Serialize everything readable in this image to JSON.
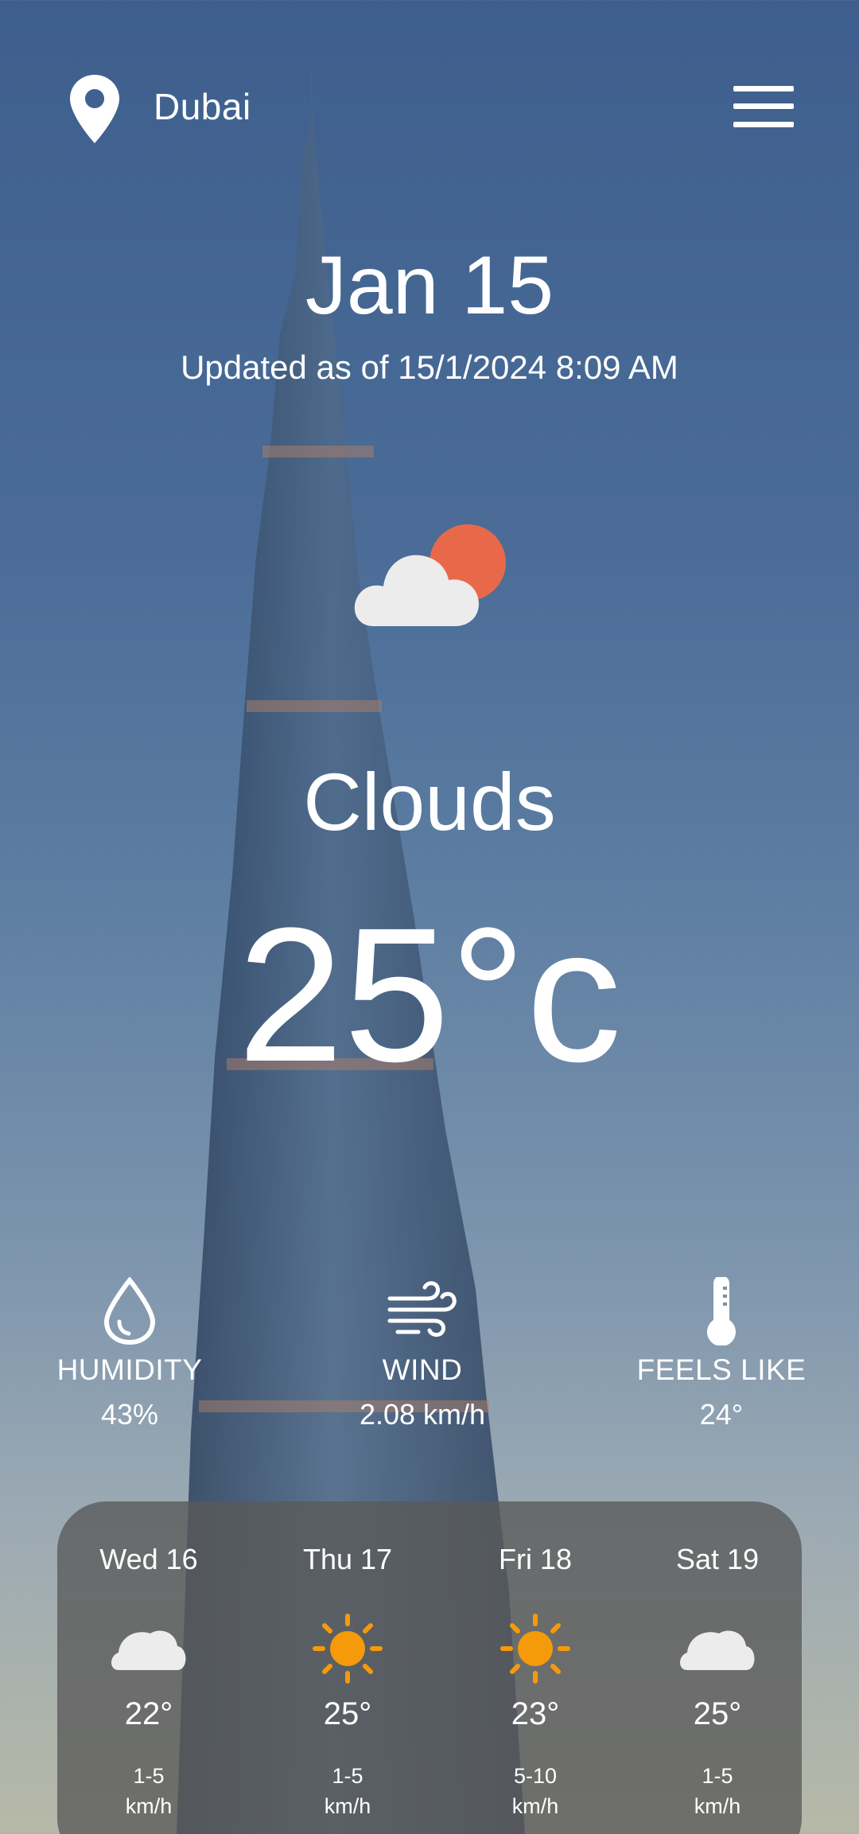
{
  "header": {
    "city": "Dubai",
    "location_icon": "location-pin-icon",
    "menu_icon": "hamburger-menu-icon"
  },
  "current": {
    "date": "Jan 15",
    "updated": "Updated as of 15/1/2024 8:09 AM",
    "condition_icon": "cloud-sun-icon",
    "condition": "Clouds",
    "temperature": "25°c"
  },
  "stats": {
    "humidity": {
      "label": "HUMIDITY",
      "value": "43%",
      "icon": "water-drop-icon"
    },
    "wind": {
      "label": "WIND",
      "value": "2.08 km/h",
      "icon": "wind-icon"
    },
    "feels_like": {
      "label": "FEELS LIKE",
      "value": "24°",
      "icon": "thermometer-icon"
    }
  },
  "forecast": [
    {
      "day": "Wed 16",
      "icon": "cloud-icon",
      "temp": "22°",
      "wind": "1-5",
      "wind_unit": "km/h"
    },
    {
      "day": "Thu 17",
      "icon": "sun-icon",
      "temp": "25°",
      "wind": "1-5",
      "wind_unit": "km/h"
    },
    {
      "day": "Fri 18",
      "icon": "sun-icon",
      "temp": "23°",
      "wind": "5-10",
      "wind_unit": "km/h"
    },
    {
      "day": "Sat 19",
      "icon": "cloud-icon",
      "temp": "25°",
      "wind": "1-5",
      "wind_unit": "km/h"
    }
  ],
  "colors": {
    "sun": "#f59a0b",
    "condition_sun": "#e8694a",
    "cloud": "#ececec",
    "panel": "#5a5a5a"
  }
}
